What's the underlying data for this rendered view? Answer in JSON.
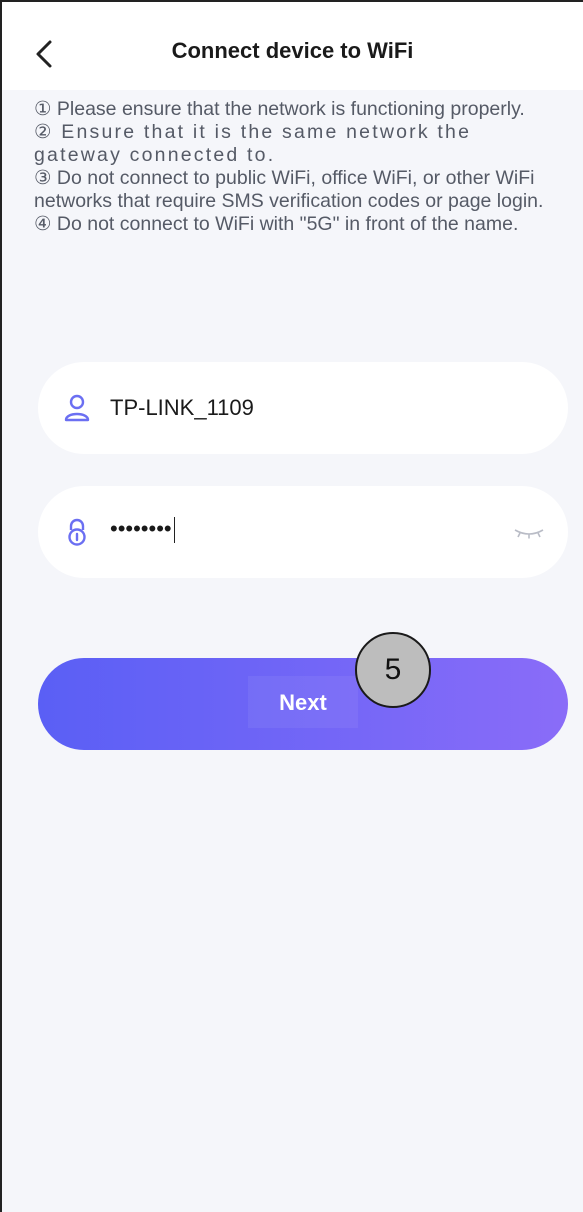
{
  "header": {
    "title": "Connect device to WiFi"
  },
  "notes": [
    "① Please ensure that the network is functioning properly.",
    "② Ensure that it is the same network the gateway connected to.",
    "③ Do not connect to public WiFi, office WiFi, or other WiFi networks that require SMS verification codes or page login.",
    "④ Do not connect to WiFi with \"5G\" in front of the name."
  ],
  "form": {
    "ssid": "TP-LINK_1109",
    "password_masked": "••••••••"
  },
  "actions": {
    "next_label": "Next"
  },
  "annotation": {
    "step_marker": "5"
  },
  "colors": {
    "accent": "#5a5ff5",
    "accent_end": "#8a6cf8",
    "icon": "#6b6ff2",
    "background": "#f5f6fa"
  }
}
